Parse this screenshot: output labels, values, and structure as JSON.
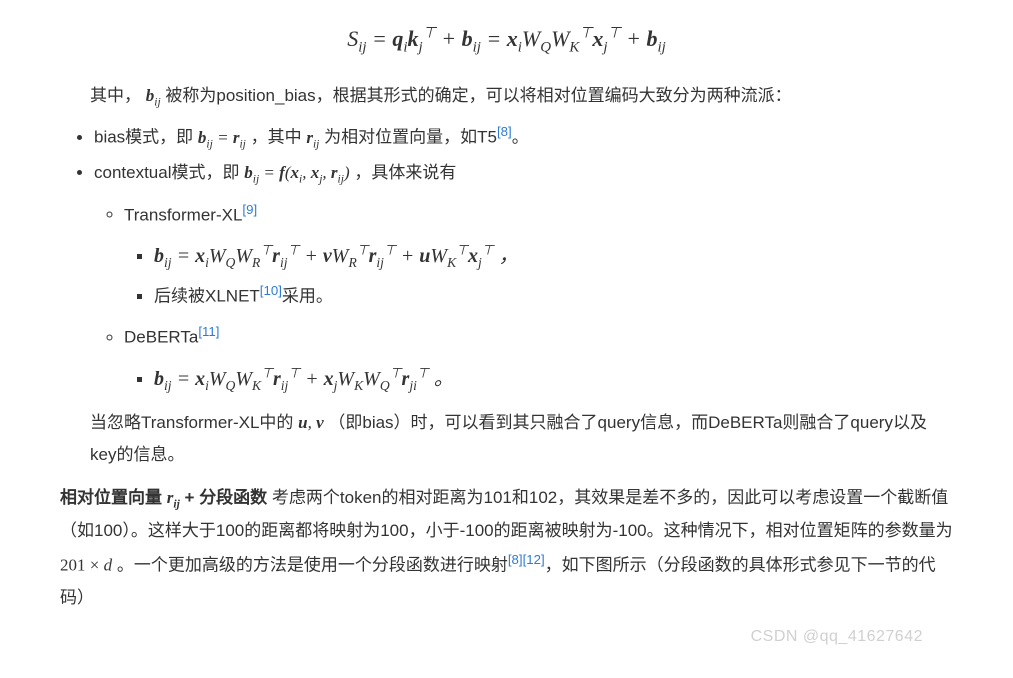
{
  "eq_main": "S<sub>ij</sub> = <span class='bf'>q</span><sub>i</sub><span class='bf'>k</span><sub>j</sub><sup>⊤</sup> + <span class='bf'>b</span><sub>ij</sub> = <span class='bf'>x</span><sub>i</sub>W<sub>Q</sub>W<sub>K</sub><sup>⊤</sup><span class='bf'>x</span><sub>j</sub><sup>⊤</sup> + <span class='bf'>b</span><sub>ij</sub>",
  "para_intro_pre": "其中，",
  "para_intro_b": "<span class='bf'>b</span><sub>ij</sub>",
  "para_intro_post": " 被称为position_bias，根据其形式的确定，可以将相对位置编码大致分为两种流派：",
  "li_bias_pre": "bias模式，即 ",
  "li_bias_eq": "<span class='bf'>b</span><sub>ij</sub> = <span class='bf'>r</span><sub>ij</sub>",
  "li_bias_mid": " ，其中 ",
  "li_bias_r": "<span class='bf'>r</span><sub>ij</sub>",
  "li_bias_post": " 为相对位置向量，如T5",
  "ref8": "[8]",
  "li_bias_end": "。",
  "li_ctx_pre": "contextual模式，即 ",
  "li_ctx_eq": "<span class='bf'>b</span><sub>ij</sub> = <span class='bf'>f</span>(<span class='bf'>x</span><sub>i</sub>, <span class='bf'>x</span><sub>j</sub>, <span class='bf'>r</span><sub>ij</sub>)",
  "li_ctx_post": " ，具体来说有",
  "li_txl": "Transformer-XL",
  "ref9": "[9]",
  "eq_txl": "<span class='bf'>b</span><sub>ij</sub> = <span class='bf'>x</span><sub>i</sub>W<sub>Q</sub>W<sub>R</sub><sup>⊤</sup><span class='bf'>r</span><sub>ij</sub><sup>⊤</sup> + <span class='bf'>v</span>W<sub>R</sub><sup>⊤</sup><span class='bf'>r</span><sub>ij</sub><sup>⊤</sup> + <span class='bf'>u</span>W<sub>K</sub><sup>⊤</sup><span class='bf'>x</span><sub>j</sub><sup>⊤</sup>   ，",
  "li_xlnet_pre": "后续被XLNET",
  "ref10": "[10]",
  "li_xlnet_post": "采用。",
  "li_deberta": "DeBERTa",
  "ref11": "[11]",
  "eq_deberta": "<span class='bf'>b</span><sub>ij</sub> = <span class='bf'>x</span><sub>i</sub>W<sub>Q</sub>W<sub>K</sub><sup>⊤</sup><span class='bf'>r</span><sub>ij</sub><sup>⊤</sup> + <span class='bf'>x</span><sub>j</sub>W<sub>K</sub>W<sub>Q</sub><sup>⊤</sup><span class='bf'>r</span><sub>ji</sub><sup>⊤</sup>   。",
  "para_ignore_pre": "当忽略Transformer-XL中的 ",
  "para_ignore_uv": "<span class='bf'>u</span>, <span class='bf'>v</span>",
  "para_ignore_post": " （即bias）时，可以看到其只融合了query信息，而DeBERTa则融合了query以及key的信息。",
  "para2_s1": "相对位置向量 ",
  "para2_r": "<span class='bf'>r</span><sub>ij</sub>",
  "para2_s2": " +",
  "para2_s3": "分段函数",
  "para2_body_a": " 考虑两个token的相对距离为101和102，其效果是差不多的，因此可以考虑设置一个截断值（如100）。这样大于100的距离都将映射为100，小于-100的距离被映射为-100。这种情况下，相对位置矩阵的参数量为 ",
  "para2_dim": "201 × <span class='math'>d</span>",
  "para2_body_b": " 。一个更加高级的方法是使用一个分段函数进行映射",
  "ref12": "[12]",
  "para2_body_c": "，如下图所示（分段函数的具体形式参见下一节的代码）",
  "watermark": "CSDN @qq_41627642"
}
